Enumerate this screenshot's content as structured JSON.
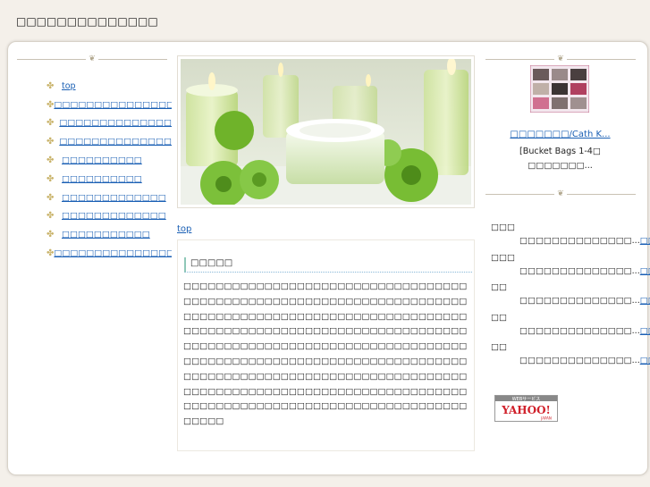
{
  "site": {
    "title": "□□□□□□□□□□□□□□"
  },
  "nav": {
    "items": [
      {
        "label": "top"
      },
      {
        "label": "□□□□□□□□□□□□□□□□□□□□□"
      },
      {
        "label": "□□□□□□□□□□□□□□"
      },
      {
        "label": "□□□□□□□□□□□□□□"
      },
      {
        "label": "□□□□□□□□□□"
      },
      {
        "label": "□□□□□□□□□□"
      },
      {
        "label": "□□□□□□□□□□□□□"
      },
      {
        "label": "□□□□□□□□□□□□□"
      },
      {
        "label": "□□□□□□□□□□□"
      },
      {
        "label": "□□□□□□□□□□□□□□□□□□□□□"
      }
    ]
  },
  "breadcrumb": {
    "label": "top"
  },
  "article": {
    "heading": "□□□□□",
    "body": "□□□□□□□□□□□□□□□□□□□□□□□□□□□□□□□□□□□□□□□□□□□□□□□□□□□□□□□□□□□□□□□□□□□□□□□□□□□□□□□□□□□□□□□□□□□□□□□□□□□□□□□□□□□□□□□□□□□□□□□□□□□□□□□□□□□□□□□□□□□□□□□□□□□□□□□□□□□□□□□□□□□□□□□□□□□□□□□□□□□□□□□□□□□□□□□□□□□□□□□□□□□□□□□□□□□□□□□□□□□□□□□□□□□□□□□□□□□□□□□□□□□□□□□□□□□□□□□□□□□□□□□□□□□□□□□□□□□□□□□□□□□□□□□□□□□□□□□□□□□□□□□□□□□□□□□□□□□□□□□□"
  },
  "promo": {
    "title": "□□□□□□□/Cath K...",
    "desc": "[Bucket Bags 1-4□ □□□□□□□..."
  },
  "news": [
    {
      "date": "□□□",
      "text": "□□□□□□□□□□□□□□...",
      "link": "□□□□□"
    },
    {
      "date": "□□□",
      "text": "□□□□□□□□□□□□□□...",
      "link": "□□□□□"
    },
    {
      "date": "□□",
      "text": "□□□□□□□□□□□□□□...",
      "link": "□□□□□"
    },
    {
      "date": "□□",
      "text": "□□□□□□□□□□□□□□...",
      "link": "□□□□□"
    },
    {
      "date": "□□",
      "text": "□□□□□□□□□□□□□□...",
      "link": "□□□□□"
    }
  ],
  "badge": {
    "small": "WEBサービス",
    "brand": "YAHOO!",
    "country": "JAPAN"
  },
  "colors": {
    "link": "#1a5fb4",
    "accent_gold": "#c9b36a",
    "background": "#f4f0ea",
    "yahoo_red": "#d0202a"
  }
}
